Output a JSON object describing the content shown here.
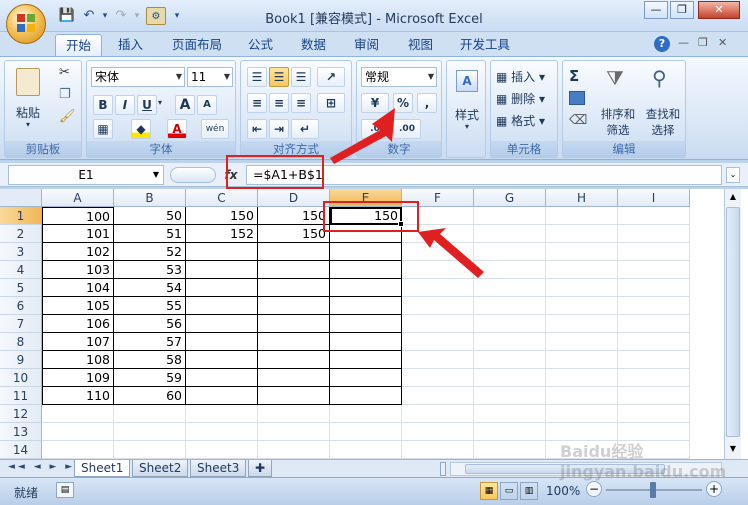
{
  "title": "Book1  [兼容模式] - Microsoft Excel",
  "window_controls": {
    "minimize": "—",
    "maximize": "❐",
    "close": "✕"
  },
  "quick_access": {
    "save": "💾",
    "undo": "↶",
    "redo": "↷",
    "customize": "▾"
  },
  "tabs": [
    "开始",
    "插入",
    "页面布局",
    "公式",
    "数据",
    "审阅",
    "视图",
    "开发工具"
  ],
  "active_tab": "开始",
  "help_icons": {
    "help": "?",
    "min": "—",
    "restore": "❐",
    "close": "✕"
  },
  "ribbon": {
    "clipboard": {
      "label": "剪贴板",
      "paste": "粘贴"
    },
    "font": {
      "label": "字体",
      "name": "宋体",
      "size": "11",
      "bold": "B",
      "italic": "I",
      "underline": "U",
      "grow": "A",
      "shrink": "A",
      "wen": "wén"
    },
    "alignment": {
      "label": "对齐方式"
    },
    "number": {
      "label": "数字",
      "format": "常规",
      "percent": "%",
      "comma": ","
    },
    "styles": {
      "label": "样式"
    },
    "cells": {
      "label": "单元格",
      "insert": "插入",
      "delete": "删除",
      "format": "格式"
    },
    "editing": {
      "label": "编辑",
      "sort_filter": "排序和\n筛选",
      "find_select": "查找和\n选择",
      "sum": "Σ"
    }
  },
  "formula_bar": {
    "name_box": "E1",
    "fx": "fx",
    "formula": "=$A1+B$1"
  },
  "columns": [
    "A",
    "B",
    "C",
    "D",
    "E",
    "F",
    "G",
    "H",
    "I"
  ],
  "rows": [
    {
      "n": "1",
      "cells": [
        "100",
        "50",
        "150",
        "150",
        "150",
        "",
        "",
        "",
        ""
      ]
    },
    {
      "n": "2",
      "cells": [
        "101",
        "51",
        "152",
        "150",
        "",
        "",
        "",
        "",
        ""
      ]
    },
    {
      "n": "3",
      "cells": [
        "102",
        "52",
        "",
        "",
        "",
        "",
        "",
        "",
        ""
      ]
    },
    {
      "n": "4",
      "cells": [
        "103",
        "53",
        "",
        "",
        "",
        "",
        "",
        "",
        ""
      ]
    },
    {
      "n": "5",
      "cells": [
        "104",
        "54",
        "",
        "",
        "",
        "",
        "",
        "",
        ""
      ]
    },
    {
      "n": "6",
      "cells": [
        "105",
        "55",
        "",
        "",
        "",
        "",
        "",
        "",
        ""
      ]
    },
    {
      "n": "7",
      "cells": [
        "106",
        "56",
        "",
        "",
        "",
        "",
        "",
        "",
        ""
      ]
    },
    {
      "n": "8",
      "cells": [
        "107",
        "57",
        "",
        "",
        "",
        "",
        "",
        "",
        ""
      ]
    },
    {
      "n": "9",
      "cells": [
        "108",
        "58",
        "",
        "",
        "",
        "",
        "",
        "",
        ""
      ]
    },
    {
      "n": "10",
      "cells": [
        "109",
        "59",
        "",
        "",
        "",
        "",
        "",
        "",
        ""
      ]
    },
    {
      "n": "11",
      "cells": [
        "110",
        "60",
        "",
        "",
        "",
        "",
        "",
        "",
        ""
      ]
    },
    {
      "n": "12",
      "cells": [
        "",
        "",
        "",
        "",
        "",
        "",
        "",
        "",
        ""
      ]
    },
    {
      "n": "13",
      "cells": [
        "",
        "",
        "",
        "",
        "",
        "",
        "",
        "",
        ""
      ]
    },
    {
      "n": "14",
      "cells": [
        "",
        "",
        "",
        "",
        "",
        "",
        "",
        "",
        ""
      ]
    }
  ],
  "sheets": [
    "Sheet1",
    "Sheet2",
    "Sheet3"
  ],
  "active_sheet": "Sheet1",
  "status": {
    "ready": "就绪",
    "zoom": "100%",
    "minus": "−",
    "plus": "+"
  },
  "watermark": "Baidu经验 jingyan.baidu.com",
  "colors": {
    "accent": "#15428b",
    "annotation": "#e02020",
    "ribbon": "#dce8f7"
  }
}
